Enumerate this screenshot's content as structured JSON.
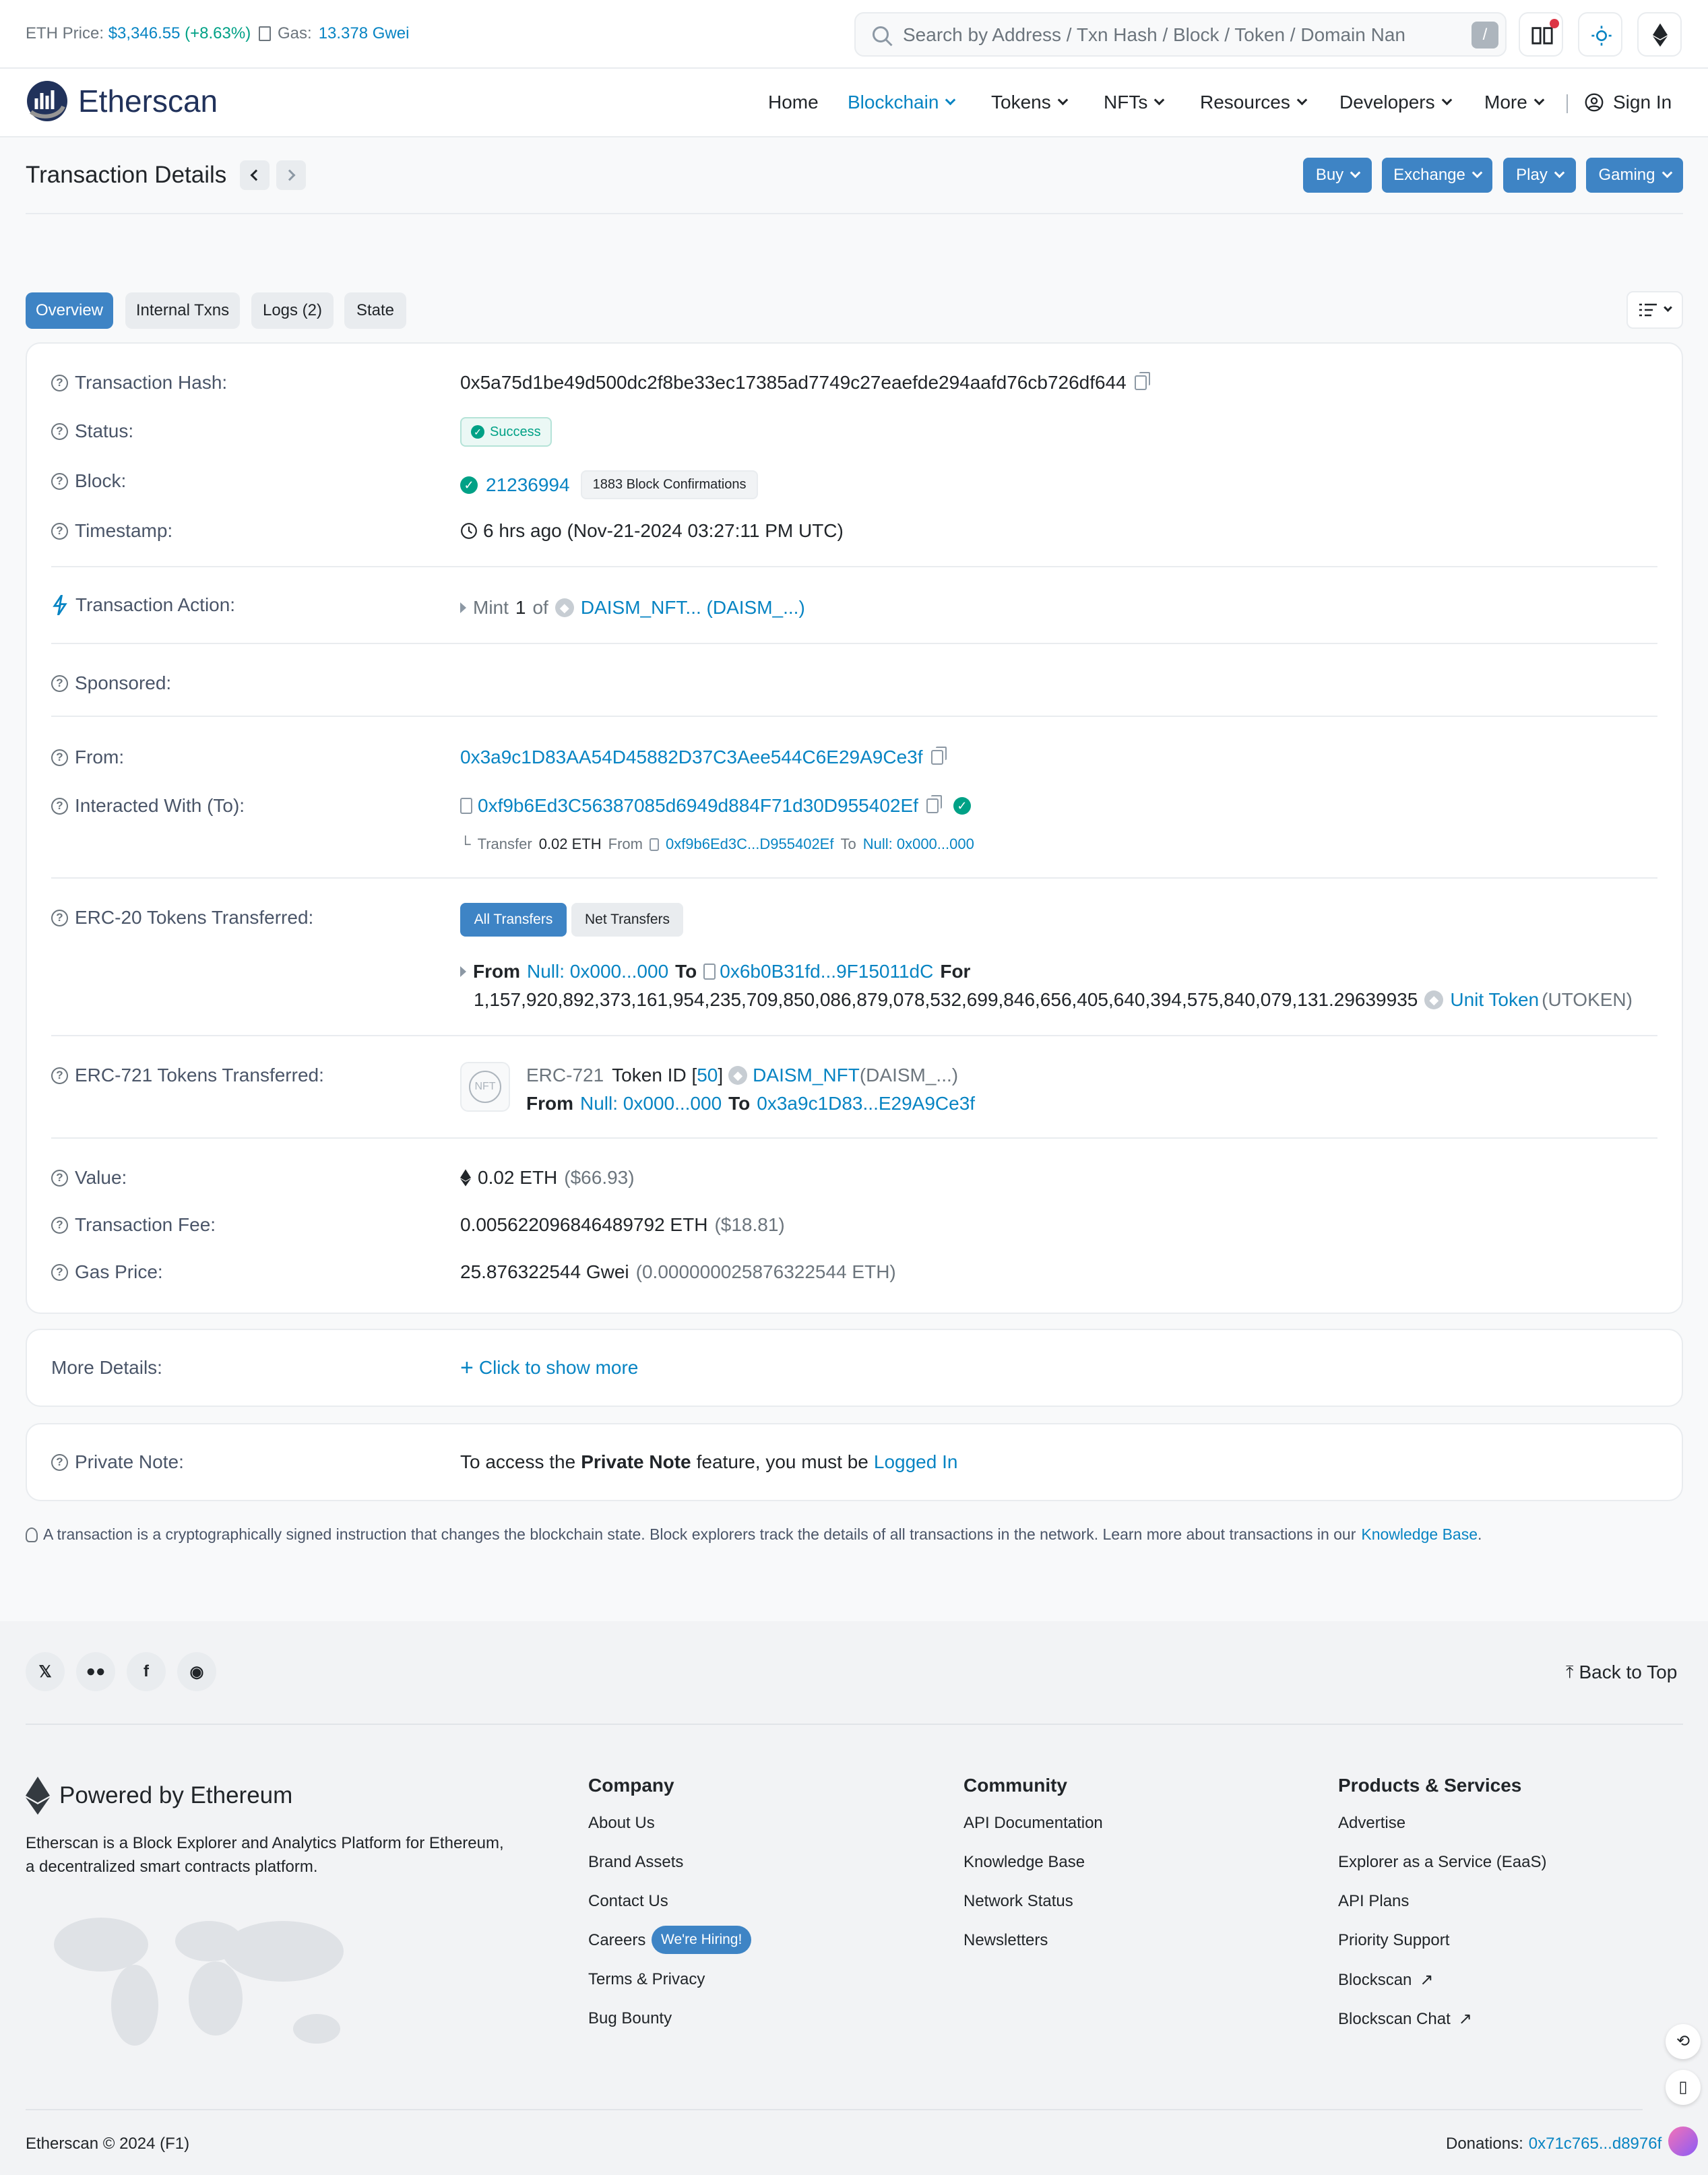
{
  "topbar": {
    "eth_price_label": "ETH Price:",
    "eth_price": "$3,346.55",
    "eth_change": "(+8.63%)",
    "gas_label": "Gas:",
    "gas_value": "13.378 Gwei",
    "search_placeholder": "Search by Address / Txn Hash / Block / Token / Domain Nan",
    "search_shortcut": "/"
  },
  "nav": {
    "brand": "Etherscan",
    "items": [
      "Home",
      "Blockchain",
      "Tokens",
      "NFTs",
      "Resources",
      "Developers",
      "More"
    ],
    "signin": "Sign In"
  },
  "page": {
    "title": "Transaction Details",
    "buttons": [
      "Buy",
      "Exchange",
      "Play",
      "Gaming"
    ]
  },
  "tabs": [
    "Overview",
    "Internal Txns",
    "Logs (2)",
    "State"
  ],
  "details": {
    "hash_label": "Transaction Hash:",
    "hash": "0x5a75d1be49d500dc2f8be33ec17385ad7749c27eaefde294aafd76cb726df644",
    "status_label": "Status:",
    "status": "Success",
    "block_label": "Block:",
    "block": "21236994",
    "confirmations": "1883 Block Confirmations",
    "timestamp_label": "Timestamp:",
    "timestamp": "6 hrs ago (Nov-21-2024 03:27:11 PM UTC)",
    "action_label": "Transaction Action:",
    "action_mint": "Mint",
    "action_count": "1",
    "action_of": "of",
    "action_token": "DAISM_NFT... (DAISM_...)",
    "sponsored_label": "Sponsored:",
    "from_label": "From:",
    "from": "0x3a9c1D83AA54D45882D37C3Aee544C6E29A9Ce3f",
    "to_label": "Interacted With (To):",
    "to": "0xf9b6Ed3C56387085d6949d884F71d30D955402Ef",
    "internal_transfer": "Transfer",
    "internal_amount": "0.02 ETH",
    "internal_from_label": "From",
    "internal_from": "0xf9b6Ed3C...D955402Ef",
    "internal_to_label": "To",
    "internal_to": "Null: 0x000...000",
    "erc20_label": "ERC-20 Tokens Transferred:",
    "erc20_tab_all": "All Transfers",
    "erc20_tab_net": "Net Transfers",
    "erc20_from_label": "From",
    "erc20_from": "Null: 0x000...000",
    "erc20_to_label": "To",
    "erc20_to": "0x6b0B31fd...9F15011dC",
    "erc20_for_label": "For",
    "erc20_amount": "1,157,920,892,373,161,954,235,709,850,086,879,078,532,699,846,656,405,640,394,575,840,079,131.29639935",
    "erc20_token": "Unit Token",
    "erc20_symbol": "(UTOKEN)",
    "erc721_label": "ERC-721 Tokens Transferred:",
    "erc721_nft_badge": "NFT",
    "erc721_type": "ERC-721",
    "erc721_tokenid_label": "Token ID [",
    "erc721_tokenid": "50",
    "erc721_tokenid_close": "]",
    "erc721_token": "DAISM_NFT",
    "erc721_symbol": "(DAISM_...)",
    "erc721_from_label": "From",
    "erc721_from": "Null: 0x000...000",
    "erc721_to_label": "To",
    "erc721_to": "0x3a9c1D83...E29A9Ce3f",
    "value_label": "Value:",
    "value": "0.02 ETH",
    "value_usd": "($66.93)",
    "fee_label": "Transaction Fee:",
    "fee": "0.005622096846489792 ETH",
    "fee_usd": "($18.81)",
    "gas_label": "Gas Price:",
    "gas": "25.876322544 Gwei",
    "gas_eth": "(0.000000025876322544 ETH)"
  },
  "more": {
    "label": "More Details:",
    "action": "Click to show more"
  },
  "note": {
    "label": "Private Note:",
    "text1": "To access the",
    "text_bold": "Private Note",
    "text2": "feature, you must be",
    "link": "Logged In"
  },
  "info": {
    "text": "A transaction is a cryptographically signed instruction that changes the blockchain state. Block explorers track the details of all transactions in the network. Learn more about transactions in our",
    "link": "Knowledge Base",
    "end": "."
  },
  "footer": {
    "back_to_top": "Back to Top",
    "powered": "Powered by Ethereum",
    "desc1": "Etherscan is a Block Explorer and Analytics Platform for Ethereum,",
    "desc2": "a decentralized smart contracts platform.",
    "company_title": "Company",
    "company": [
      "About Us",
      "Brand Assets",
      "Contact Us",
      "Careers",
      "Terms & Privacy",
      "Bug Bounty"
    ],
    "hiring": "We're Hiring!",
    "community_title": "Community",
    "community": [
      "API Documentation",
      "Knowledge Base",
      "Network Status",
      "Newsletters"
    ],
    "products_title": "Products & Services",
    "products": [
      "Advertise",
      "Explorer as a Service (EaaS)",
      "API Plans",
      "Priority Support",
      "Blockscan",
      "Blockscan Chat"
    ],
    "copyright": "Etherscan © 2024 (F1)",
    "donations_label": "Donations:",
    "donations": "0x71c765...d8976f"
  },
  "colors": {
    "accent": "#0784c3",
    "button": "#3e84c5",
    "success": "#00a186"
  }
}
